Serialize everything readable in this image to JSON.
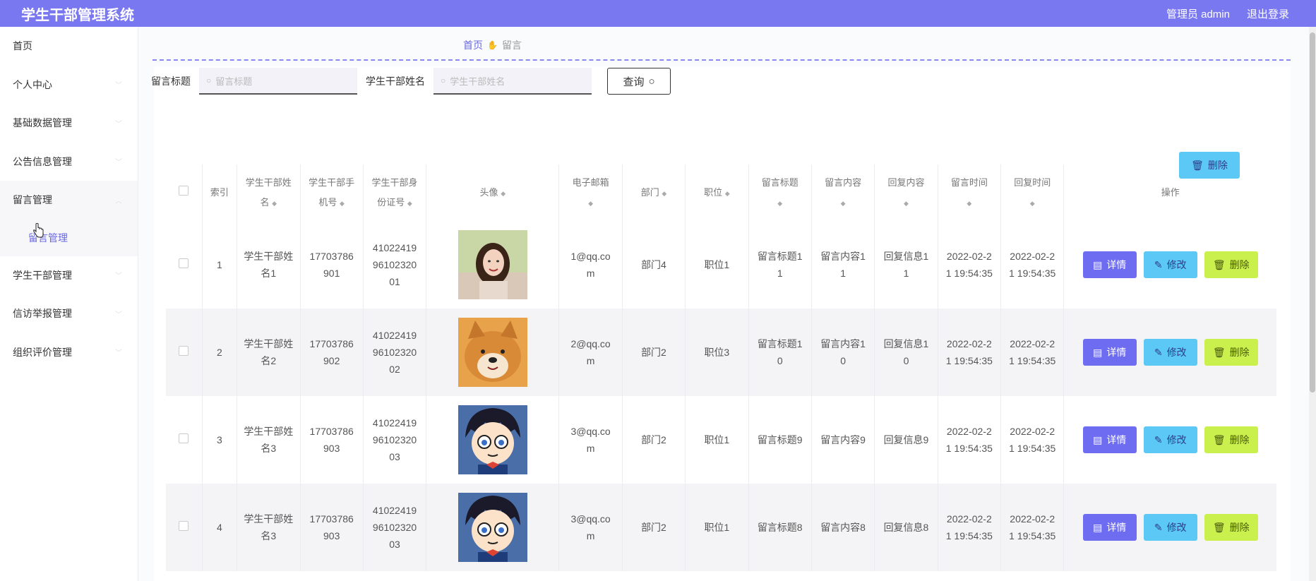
{
  "app": {
    "title": "学生干部管理系统",
    "user": "管理员 admin",
    "logout": "退出登录"
  },
  "sidebar": {
    "items": [
      {
        "label": "首页"
      },
      {
        "label": "个人中心"
      },
      {
        "label": "基础数据管理"
      },
      {
        "label": "公告信息管理"
      },
      {
        "label": "留言管理"
      },
      {
        "label": "学生干部管理"
      },
      {
        "label": "信访举报管理"
      },
      {
        "label": "组织评价管理"
      }
    ],
    "sub_item": "留言管理"
  },
  "breadcrumb": {
    "home": "首页",
    "current": "留言"
  },
  "search": {
    "title_label": "留言标题",
    "title_placeholder": "留言标题",
    "name_label": "学生干部姓名",
    "name_placeholder": "学生干部姓名",
    "query_label": "查询"
  },
  "toolbar": {
    "delete_label": "删除"
  },
  "table": {
    "headers": {
      "index": "索引",
      "name_1": "学生干部姓",
      "name_2": "名",
      "phone_1": "学生干部手",
      "phone_2": "机号",
      "id_1": "学生干部身",
      "id_2": "份证号",
      "avatar": "头像",
      "email": "电子邮箱",
      "dept": "部门",
      "position": "职位",
      "msg_title": "留言标题",
      "msg_content": "留言内容",
      "reply_content": "回复内容",
      "msg_time": "留言时间",
      "reply_time": "回复时间",
      "ops": "操作"
    },
    "rows": [
      {
        "index": "1",
        "name_1": "学生干部姓",
        "name_2": "名1",
        "phone_1": "17703786",
        "phone_2": "901",
        "id_1": "41022419",
        "id_2": "96102320",
        "id_3": "01",
        "email_1": "1@qq.co",
        "email_2": "m",
        "dept": "部门4",
        "position": "职位1",
        "title_1": "留言标题1",
        "title_2": "1",
        "content_1": "留言内容1",
        "content_2": "1",
        "reply_1": "回复信息1",
        "reply_2": "1",
        "mtime_1": "2022-02-2",
        "mtime_2": "1 19:54:35",
        "rtime_1": "2022-02-2",
        "rtime_2": "1 19:54:35",
        "avatar": "girl"
      },
      {
        "index": "2",
        "name_1": "学生干部姓",
        "name_2": "名2",
        "phone_1": "17703786",
        "phone_2": "902",
        "id_1": "41022419",
        "id_2": "96102320",
        "id_3": "02",
        "email_1": "2@qq.co",
        "email_2": "m",
        "dept": "部门2",
        "position": "职位3",
        "title_1": "留言标题1",
        "title_2": "0",
        "content_1": "留言内容1",
        "content_2": "0",
        "reply_1": "回复信息1",
        "reply_2": "0",
        "mtime_1": "2022-02-2",
        "mtime_2": "1 19:54:35",
        "rtime_1": "2022-02-2",
        "rtime_2": "1 19:54:35",
        "avatar": "dog"
      },
      {
        "index": "3",
        "name_1": "学生干部姓",
        "name_2": "名3",
        "phone_1": "17703786",
        "phone_2": "903",
        "id_1": "41022419",
        "id_2": "96102320",
        "id_3": "03",
        "email_1": "3@qq.co",
        "email_2": "m",
        "dept": "部门2",
        "position": "职位1",
        "title_1": "留言标题9",
        "title_2": "",
        "content_1": "留言内容9",
        "content_2": "",
        "reply_1": "回复信息9",
        "reply_2": "",
        "mtime_1": "2022-02-2",
        "mtime_2": "1 19:54:35",
        "rtime_1": "2022-02-2",
        "rtime_2": "1 19:54:35",
        "avatar": "cartoon"
      },
      {
        "index": "4",
        "name_1": "学生干部姓",
        "name_2": "名3",
        "phone_1": "17703786",
        "phone_2": "903",
        "id_1": "41022419",
        "id_2": "96102320",
        "id_3": "03",
        "email_1": "3@qq.co",
        "email_2": "m",
        "dept": "部门2",
        "position": "职位1",
        "title_1": "留言标题8",
        "title_2": "",
        "content_1": "留言内容8",
        "content_2": "",
        "reply_1": "回复信息8",
        "reply_2": "",
        "mtime_1": "2022-02-2",
        "mtime_2": "1 19:54:35",
        "rtime_1": "2022-02-2",
        "rtime_2": "1 19:54:35",
        "avatar": "cartoon"
      }
    ],
    "op_labels": {
      "detail": "详情",
      "edit": "修改",
      "delete": "删除"
    }
  },
  "colors": {
    "primary": "#7a78f0",
    "info": "#5bc8f5",
    "danger": "#c9f04c"
  }
}
